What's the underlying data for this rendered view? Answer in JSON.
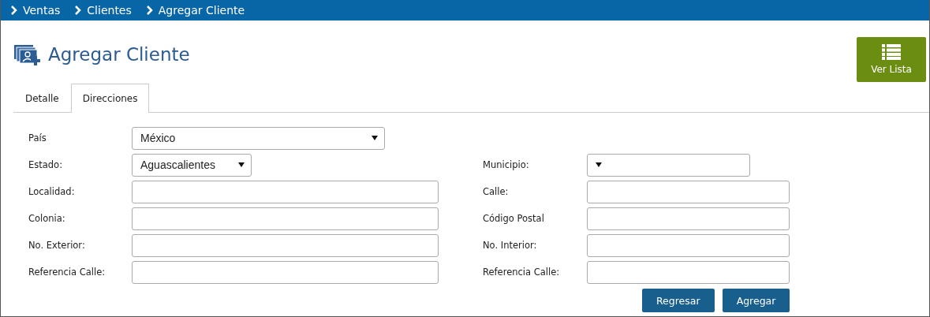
{
  "breadcrumb": [
    "Ventas",
    "Clientes",
    "Agregar Cliente"
  ],
  "title": "Agregar Cliente",
  "list_button": "Ver Lista",
  "tabs": [
    {
      "label": "Detalle",
      "selected": false
    },
    {
      "label": "Direcciones",
      "selected": true
    }
  ],
  "form": {
    "left": [
      {
        "label": "País",
        "kind": "select",
        "value": "México"
      },
      {
        "label": "Estado:",
        "kind": "select",
        "value": "Aguascalientes"
      },
      {
        "label": "Localidad:",
        "kind": "text"
      },
      {
        "label": "Colonia:",
        "kind": "text"
      },
      {
        "label": "No. Exterior:",
        "kind": "text"
      },
      {
        "label": "Referencia Calle:",
        "kind": "text"
      }
    ],
    "right": [
      {
        "label": "Municipio:",
        "kind": "select"
      },
      {
        "label": "Calle:",
        "kind": "text"
      },
      {
        "label": "Código Postal",
        "kind": "text"
      },
      {
        "label": "No. Interior:",
        "kind": "text"
      },
      {
        "label": "Referencia Calle:",
        "kind": "text"
      }
    ]
  },
  "buttons": [
    "Regresar",
    "Agregar"
  ]
}
